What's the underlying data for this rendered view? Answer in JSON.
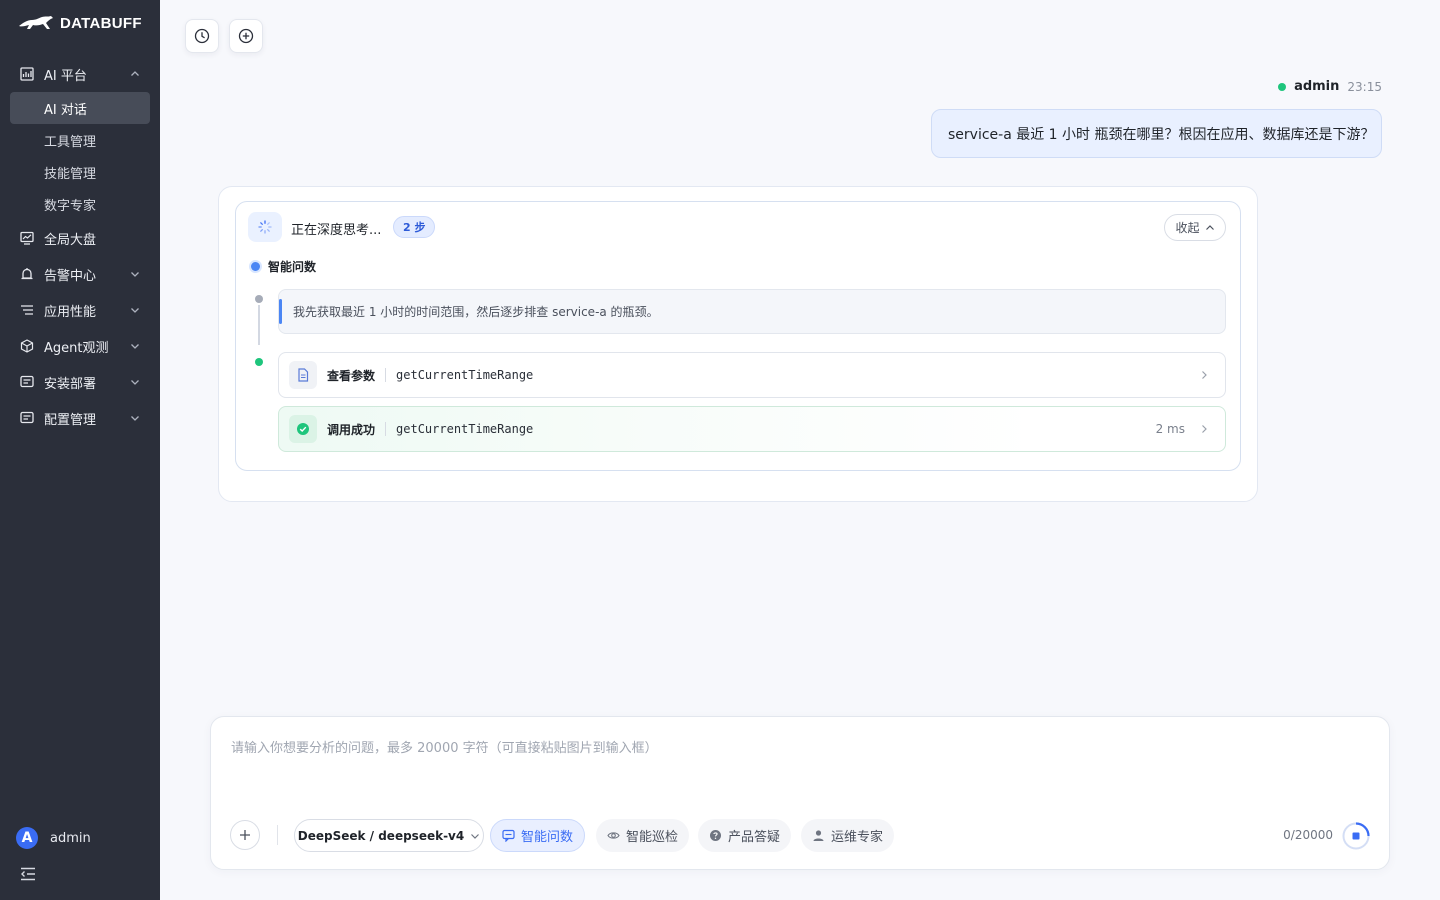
{
  "app": {
    "logo_text": "DATABUFF"
  },
  "sidebar": {
    "groups": [
      {
        "label": "AI 平台",
        "icon": "chart-icon",
        "expanded": true,
        "children": [
          {
            "label": "AI 对话",
            "active": true
          },
          {
            "label": "工具管理"
          },
          {
            "label": "技能管理"
          },
          {
            "label": "数字专家"
          }
        ]
      },
      {
        "label": "全局大盘",
        "icon": "dashboard-icon"
      },
      {
        "label": "告警中心",
        "icon": "alarm-icon"
      },
      {
        "label": "应用性能",
        "icon": "list-icon"
      },
      {
        "label": "Agent观测",
        "icon": "cube-icon"
      },
      {
        "label": "安装部署",
        "icon": "install-icon"
      },
      {
        "label": "配置管理",
        "icon": "config-icon"
      }
    ],
    "user": {
      "initial": "A",
      "name": "admin"
    }
  },
  "conversation": {
    "user_message": {
      "author": "admin",
      "time": "23:15",
      "text": "service-a 最近 1 小时 瓶颈在哪里？根因在应用、数据库还是下游？"
    },
    "thinking": {
      "title": "正在深度思考...",
      "steps_badge": "2 步",
      "collapse_label": "收起",
      "section_title": "智能问数",
      "note": "我先获取最近 1 小时的时间范围，然后逐步排查 service-a 的瓶颈。",
      "tool_params": {
        "label": "查看参数",
        "function": "getCurrentTimeRange"
      },
      "tool_success": {
        "label": "调用成功",
        "function": "getCurrentTimeRange",
        "duration": "2 ms"
      }
    }
  },
  "composer": {
    "placeholder": "请输入你想要分析的问题，最多 20000 字符（可直接粘贴图片到输入框）",
    "model": "DeepSeek / deepseek-v4",
    "modes": [
      {
        "label": "智能问数",
        "active": true
      },
      {
        "label": "智能巡检"
      },
      {
        "label": "产品答疑"
      },
      {
        "label": "运维专家"
      }
    ],
    "counter": "0/20000"
  },
  "colors": {
    "sidebar_bg": "#2b2f3a",
    "accent": "#3a6cf4",
    "success": "#1ec57c"
  }
}
